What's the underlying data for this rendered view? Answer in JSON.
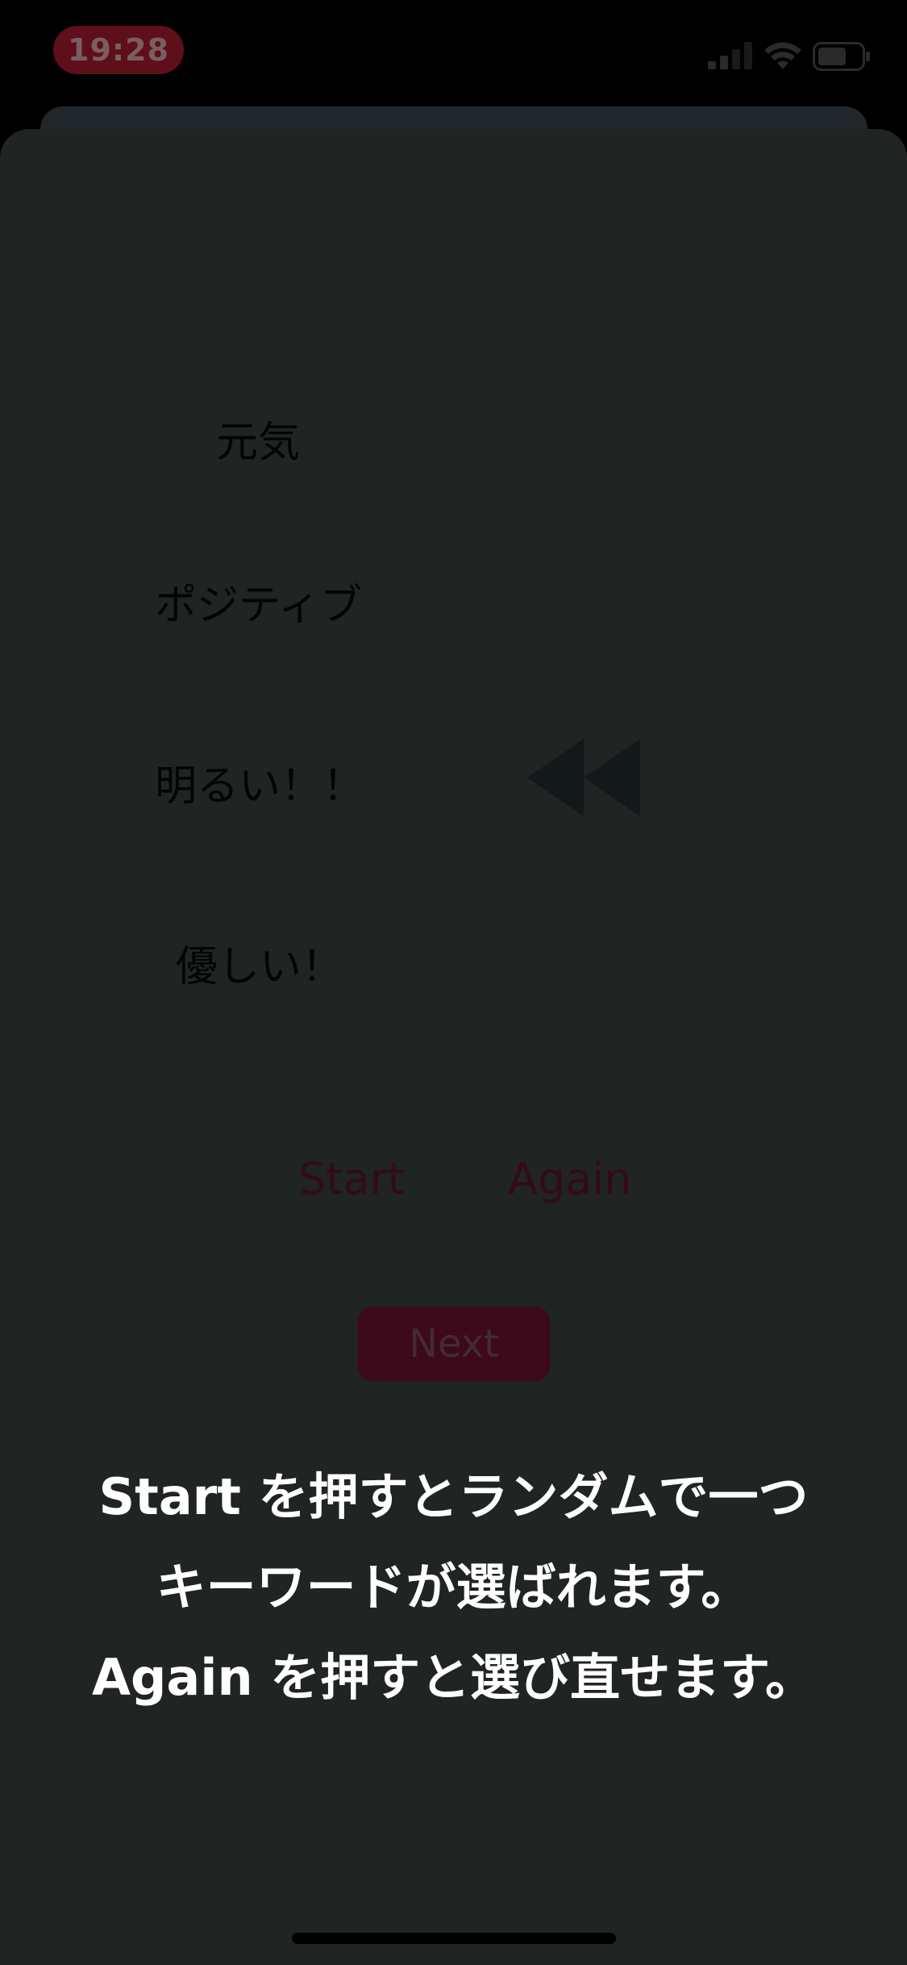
{
  "status_bar": {
    "time": "19:28",
    "icons": [
      "signal-icon",
      "wifi-icon",
      "battery-icon"
    ]
  },
  "keywords": [
    "元気",
    "ポジティブ",
    "明るい！！",
    "優しい！"
  ],
  "controls": {
    "rewind_icon": "rewind-icon",
    "start_label": "Start",
    "again_label": "Again",
    "next_label": "Next"
  },
  "instructions": [
    "Start を押すとランダムで一つ",
    "キーワードが選ばれます。",
    "Again を押すと選び直せます。"
  ],
  "colors": {
    "background": "#202423",
    "accent": "#3c0a1a",
    "time_pill": "#5e0f1a",
    "instruction_text": "#ffffff"
  }
}
